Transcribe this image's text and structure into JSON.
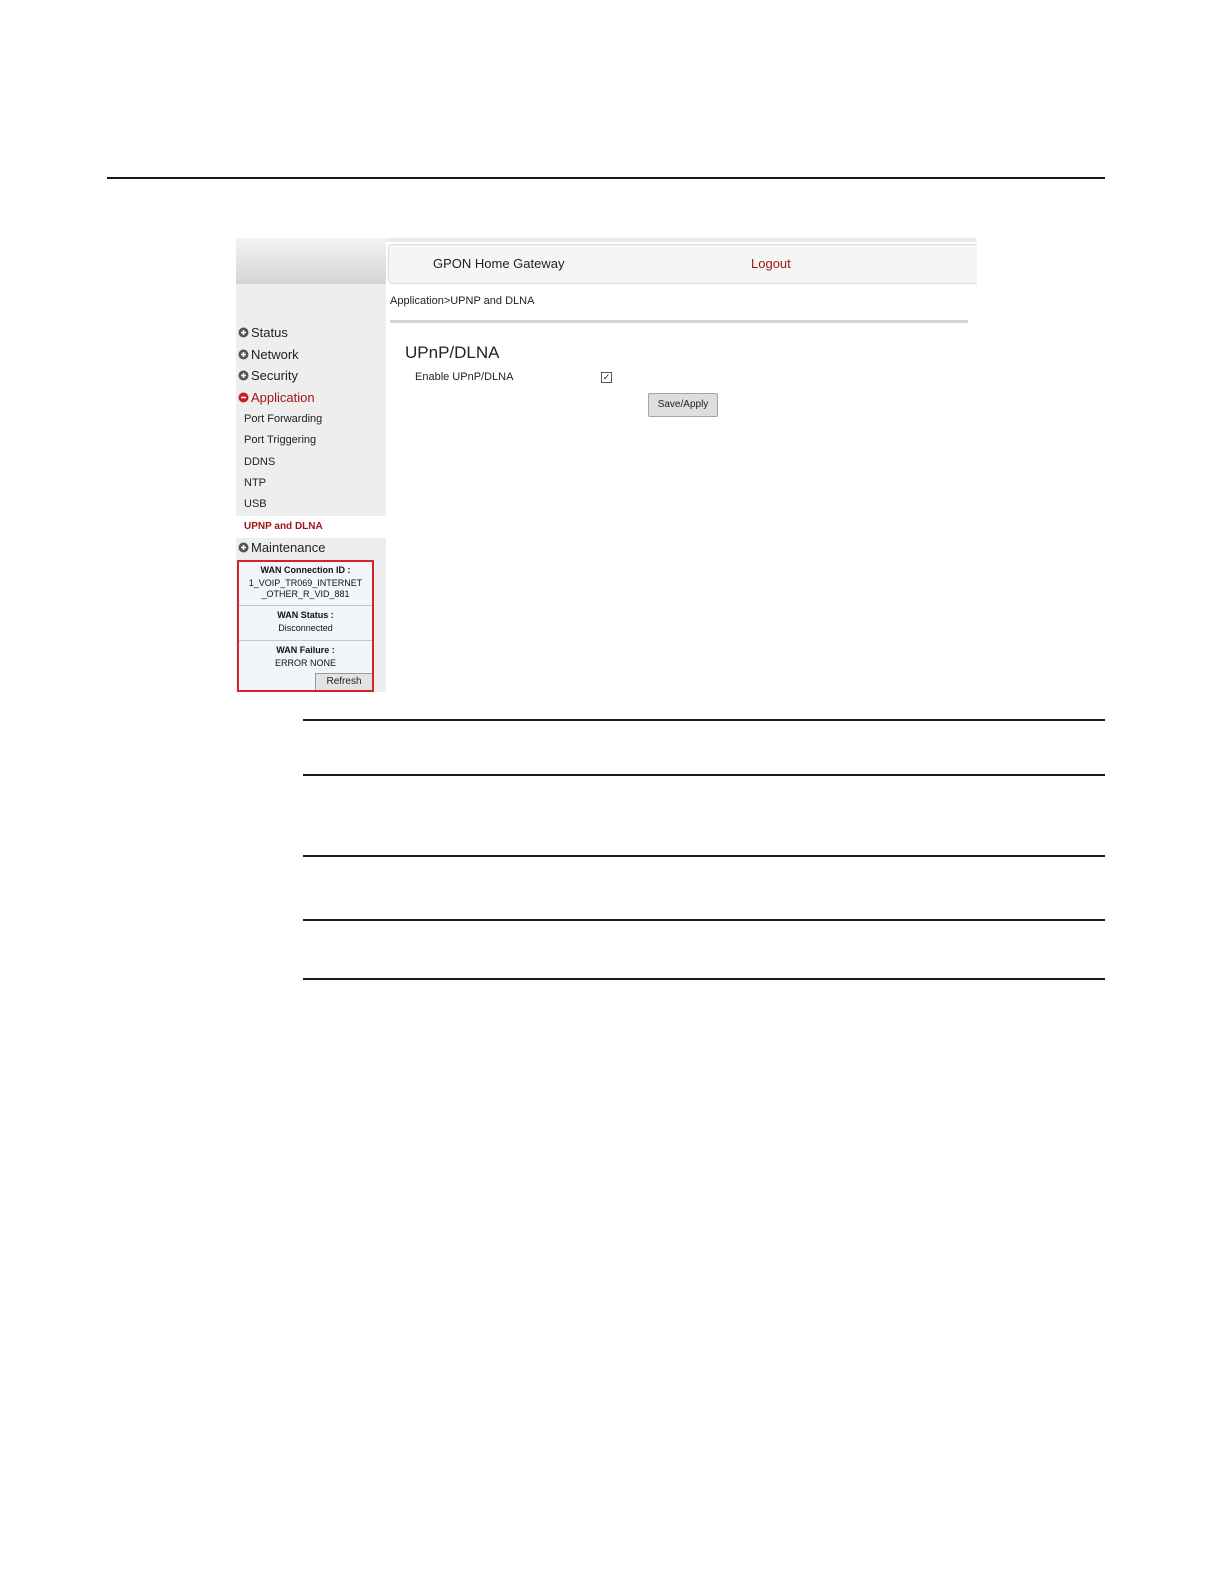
{
  "header": {
    "app_title": "GPON Home Gateway",
    "logout_label": "Logout"
  },
  "breadcrumb": "Application>UPNP and DLNA",
  "sidebar": {
    "top_items": [
      {
        "label": "Status",
        "icon": "plus-icon"
      },
      {
        "label": "Network",
        "icon": "plus-icon"
      },
      {
        "label": "Security",
        "icon": "plus-icon"
      },
      {
        "label": "Application",
        "icon": "minus-icon",
        "active": true
      },
      {
        "label": "Maintenance",
        "icon": "plus-icon"
      }
    ],
    "application_subitems": [
      {
        "label": "Port Forwarding"
      },
      {
        "label": "Port Triggering"
      },
      {
        "label": "DDNS"
      },
      {
        "label": "NTP"
      },
      {
        "label": "USB"
      },
      {
        "label": "UPNP and DLNA",
        "active": true
      }
    ]
  },
  "wan": {
    "connection_label": "WAN Connection ID :",
    "connection_value_line1": "1_VOIP_TR069_INTERNET",
    "connection_value_line2": "_OTHER_R_VID_881",
    "status_label": "WAN Status :",
    "status_value": "Disconnected",
    "failure_label": "WAN Failure :",
    "failure_value": "ERROR NONE",
    "refresh_label": "Refresh"
  },
  "main": {
    "title": "UPnP/DLNA",
    "enable_label": "Enable UPnP/DLNA",
    "enable_checked": true,
    "save_label": "Save/Apply"
  },
  "colors": {
    "accent_red": "#a01515",
    "wan_border": "#d6232a"
  }
}
